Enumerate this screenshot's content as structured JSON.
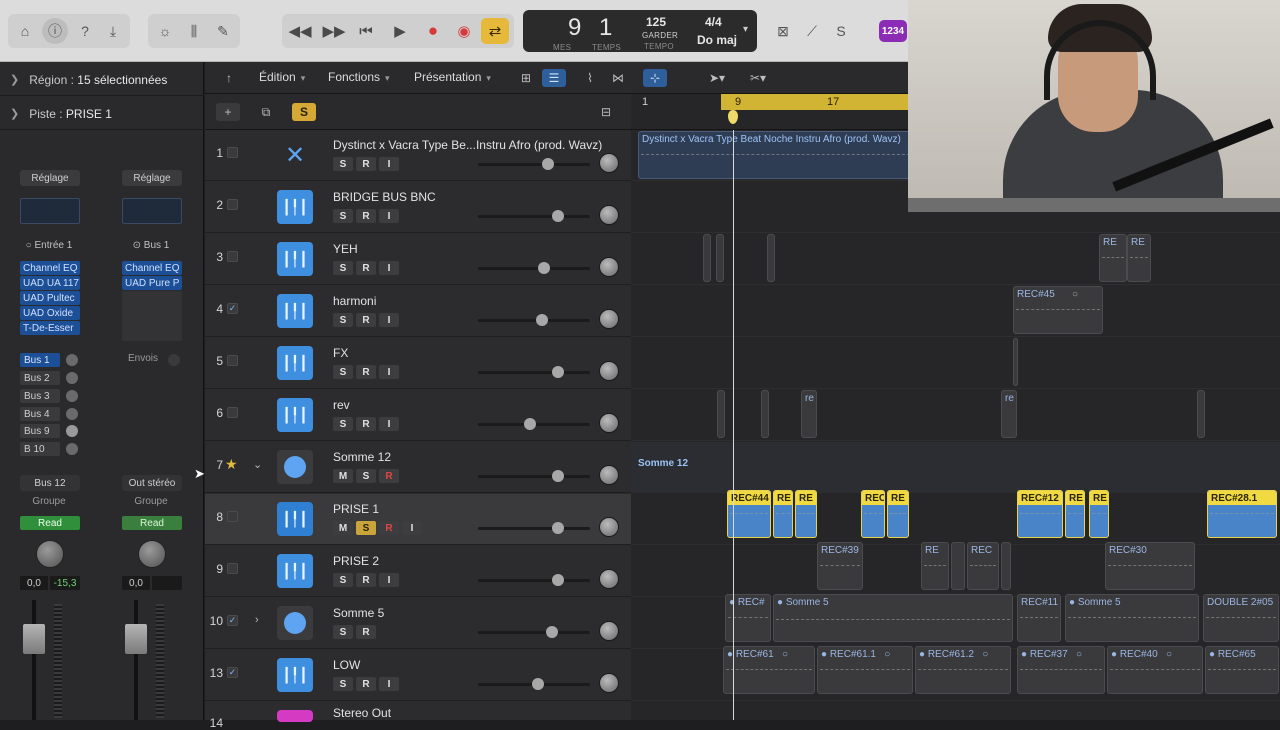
{
  "transport_bar": {
    "lcd": {
      "bars": "9",
      "beats": "1",
      "bars_label": "MES",
      "beats_label": "TEMPS",
      "tempo": "125",
      "tempo_mode": "GARDER",
      "tempo_label": "TEMPO",
      "signature": "4/4",
      "key": "Do maj"
    },
    "count_in_badge": "1234"
  },
  "inspector": {
    "region_label": "Région :",
    "region_value": "15 sélectionnées",
    "track_label": "Piste :",
    "track_value": "PRISE 1",
    "strip_left": {
      "settings": "Réglage",
      "input": "Entrée 1",
      "plugins": [
        "Channel EQ",
        "UAD UA 117",
        "UAD Pultec",
        "UAD Oxide",
        "T-De-Esser"
      ],
      "sends": [
        "Bus 1",
        "Bus 2",
        "Bus 3",
        "Bus 4",
        "Bus 9",
        "B 10"
      ],
      "output": "Bus 12",
      "group": "Groupe",
      "automation": "Read",
      "volume": "0,0",
      "peak": "-15,3"
    },
    "strip_right": {
      "settings": "Réglage",
      "input": "Bus 1",
      "plugins": [
        "Channel EQ",
        "UAD Pure P"
      ],
      "sends_label": "Envois",
      "output": "Out stéréo",
      "group": "Groupe",
      "automation": "Read",
      "volume": "0,0"
    }
  },
  "toolbar": {
    "menus": [
      "Édition",
      "Fonctions",
      "Présentation"
    ],
    "solo_btn": "S"
  },
  "ruler": {
    "marks": [
      "1",
      "9",
      "17"
    ]
  },
  "tracks": [
    {
      "num": "1",
      "name": "Dystinct x Vacra Type Be...Instru Afro (prod. Wavz)",
      "type": "audio-x",
      "checked": false,
      "m": "",
      "s": "S",
      "r": "R",
      "i": "I",
      "vol": 0.65
    },
    {
      "num": "2",
      "name": "BRIDGE BUS BNC",
      "type": "audio",
      "checked": false,
      "s": "S",
      "r": "R",
      "i": "I",
      "vol": 0.72
    },
    {
      "num": "3",
      "name": "YEH",
      "type": "audio",
      "checked": false,
      "s": "S",
      "r": "R",
      "i": "I",
      "vol": 0.58
    },
    {
      "num": "4",
      "name": "harmoni",
      "type": "audio",
      "checked": true,
      "s": "S",
      "r": "R",
      "i": "I",
      "vol": 0.57
    },
    {
      "num": "5",
      "name": "FX",
      "type": "audio",
      "checked": false,
      "s": "S",
      "r": "R",
      "i": "I",
      "vol": 0.72
    },
    {
      "num": "6",
      "name": "rev",
      "type": "audio",
      "checked": false,
      "s": "S",
      "r": "R",
      "i": "I",
      "vol": 0.46
    },
    {
      "num": "7",
      "name": "Somme 12",
      "type": "folder",
      "checked": false,
      "star": true,
      "m": "M",
      "s": "S",
      "r": "R",
      "vol": 0.72
    },
    {
      "num": "8",
      "name": "PRISE 1",
      "type": "audio",
      "checked": false,
      "selected": true,
      "m": "M",
      "s": "S",
      "r": "R",
      "i": "I",
      "vol": 0.72
    },
    {
      "num": "9",
      "name": "PRISE 2",
      "type": "audio",
      "checked": false,
      "s": "S",
      "r": "R",
      "i": "I",
      "vol": 0.72
    },
    {
      "num": "10",
      "name": "Somme 5",
      "type": "folder",
      "checked": true,
      "s": "S",
      "r": "R",
      "vol": 0.67
    },
    {
      "num": "13",
      "name": "LOW",
      "type": "audio",
      "checked": true,
      "s": "S",
      "r": "R",
      "i": "I",
      "vol": 0.53
    },
    {
      "num": "14",
      "name": "Stereo Out",
      "type": "output"
    }
  ],
  "regions": {
    "lane1": "Dystinct x Vacra Type Beat Noche  Instru Afro (prod. Wavz)",
    "lane3": [
      "RE",
      "RE"
    ],
    "lane4": "REC#45",
    "lane6": [
      "re",
      "re"
    ],
    "lane7": "Somme 12",
    "lane8": [
      "REC#44",
      "RE",
      "RE",
      "REC",
      "RE",
      "REC#12",
      "RE",
      "RE",
      "REC#28.1"
    ],
    "lane9": [
      "REC#39",
      "RE",
      "REC",
      "REC#30"
    ],
    "lane10": [
      "REC#",
      "Somme 5",
      "REC#11",
      "Somme 5",
      "DOUBLE 2#05"
    ],
    "lane13": [
      "REC#61",
      "REC#61.1",
      "REC#61.2",
      "REC#37",
      "REC#40",
      "REC#65"
    ]
  },
  "colors": {
    "accent": "#3f8fe0",
    "region_yellow": "#f0d941",
    "read_green": "#2f8f3a",
    "record_red": "#d63a3a"
  }
}
